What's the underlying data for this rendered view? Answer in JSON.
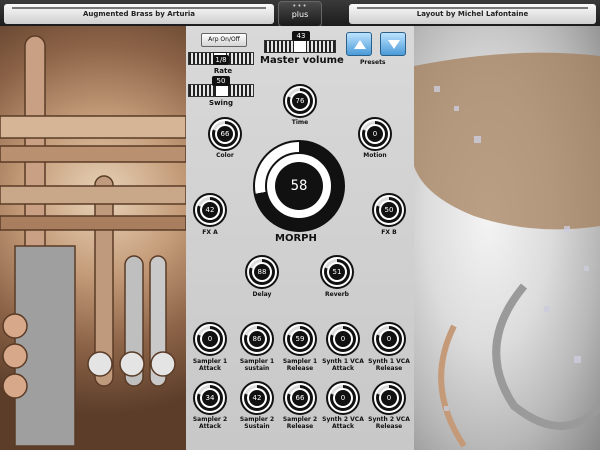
{
  "header": {
    "left_title": "Augmented Brass by Arturia",
    "right_title": "Layout by Michel Lafontaine",
    "center_button": "plus",
    "center_dots": "•••"
  },
  "controls": {
    "arp_button": "Arp On/Off",
    "rate": {
      "label": "Rate",
      "value": "1/8"
    },
    "swing": {
      "label": "Swing",
      "value": "50"
    },
    "master_volume": {
      "label": "Master volume",
      "value": "43"
    },
    "presets_label": "Presets"
  },
  "knobs": {
    "time": {
      "label": "Time",
      "value": "76"
    },
    "color": {
      "label": "Color",
      "value": "66"
    },
    "motion": {
      "label": "Motion",
      "value": "0"
    },
    "fx_a": {
      "label": "FX A",
      "value": "42"
    },
    "fx_b": {
      "label": "FX B",
      "value": "50"
    },
    "morph": {
      "label": "MORPH",
      "value": "58"
    },
    "delay": {
      "label": "Delay",
      "value": "88"
    },
    "reverb": {
      "label": "Reverb",
      "value": "51"
    }
  },
  "envelope_row1": [
    {
      "label": "Sampler 1\nAttack",
      "value": "0"
    },
    {
      "label": "Sampler 1\nsustain",
      "value": "86"
    },
    {
      "label": "Sampler 1\nRelease",
      "value": "59"
    },
    {
      "label": "Synth 1 VCA\nAttack",
      "value": "0"
    },
    {
      "label": "Synth 1 VCA\nRelease",
      "value": "0"
    }
  ],
  "envelope_row2": [
    {
      "label": "Sampler 2\nAttack",
      "value": "34"
    },
    {
      "label": "Sampler 2\nSustain",
      "value": "42"
    },
    {
      "label": "Sampler 2\nRelease",
      "value": "66"
    },
    {
      "label": "Synth 2 VCA\nAttack",
      "value": "0"
    },
    {
      "label": "Synth 2 VCA\nRelease",
      "value": "0"
    }
  ]
}
